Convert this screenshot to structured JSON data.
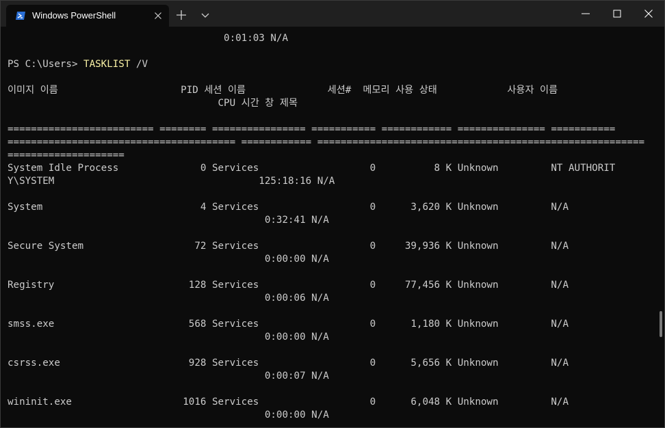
{
  "window": {
    "tab_title": "Windows PowerShell",
    "tab_icon": "powershell-icon",
    "controls": [
      "minimize-icon",
      "maximize-icon",
      "close-icon"
    ]
  },
  "terminal": {
    "prompt": "PS C:\\Users> ",
    "command": "TASKLIST",
    "command_args": " /V",
    "lines": [
      "                                     0:01:03 N/A",
      "이미지 이름                     PID 세션 이름              세션#  메모리 사용 상태            사용자 이름",
      "                                    CPU 시간 창 제목",
      "========================= ======== ================ =========== ============ =============== ===========",
      "======================================= ============ ========================================================",
      "====================",
      "System Idle Process              0 Services                   0          8 K Unknown         NT AUTHORIT",
      "Y\\SYSTEM                                   125:18:16 N/A",
      "System                           4 Services                   0      3,620 K Unknown         N/A",
      "                                            0:32:41 N/A",
      "Secure System                   72 Services                   0     39,936 K Unknown         N/A",
      "                                            0:00:00 N/A",
      "Registry                       128 Services                   0     77,456 K Unknown         N/A",
      "                                            0:00:06 N/A",
      "smss.exe                       568 Services                   0      1,180 K Unknown         N/A",
      "                                            0:00:00 N/A",
      "csrss.exe                      928 Services                   0      5,656 K Unknown         N/A",
      "                                            0:00:07 N/A",
      "wininit.exe                   1016 Services                   0      6,048 K Unknown         N/A",
      "                                            0:00:00 N/A"
    ]
  }
}
